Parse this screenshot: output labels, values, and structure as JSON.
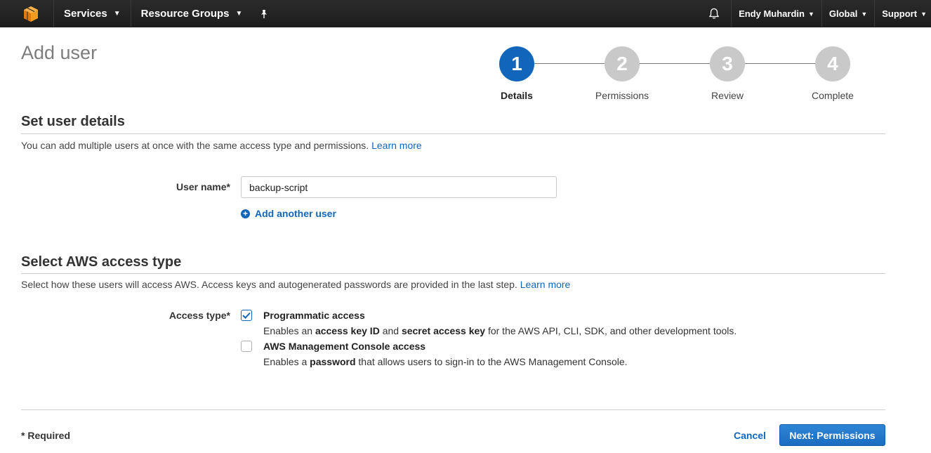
{
  "topnav": {
    "logo_icon": "aws-cube-icon",
    "services": "Services",
    "resource_groups": "Resource Groups",
    "pin_icon": "pin-icon",
    "bell_icon": "bell-icon",
    "user": "Endy Muhardin",
    "region": "Global",
    "support": "Support"
  },
  "page": {
    "title": "Add user"
  },
  "wizard": {
    "steps": [
      {
        "number": "1",
        "label": "Details",
        "active": true
      },
      {
        "number": "2",
        "label": "Permissions",
        "active": false
      },
      {
        "number": "3",
        "label": "Review",
        "active": false
      },
      {
        "number": "4",
        "label": "Complete",
        "active": false
      }
    ]
  },
  "user_details": {
    "title": "Set user details",
    "description": "You can add multiple users at once with the same access type and permissions.",
    "learn_more": "Learn more",
    "user_name_label": "User name*",
    "user_name_value": "backup-script",
    "add_another": "Add another user"
  },
  "access_type": {
    "title": "Select AWS access type",
    "description": "Select how these users will access AWS. Access keys and autogenerated passwords are provided in the last step.",
    "learn_more": "Learn more",
    "label": "Access type*",
    "options": [
      {
        "title": "Programmatic access",
        "checked": true,
        "desc_1": "Enables an ",
        "desc_2": "access key ID",
        "desc_3": " and ",
        "desc_4": "secret access key",
        "desc_5": " for the AWS API, CLI, SDK, and other development tools."
      },
      {
        "title": "AWS Management Console access",
        "checked": false,
        "desc_1": "Enables a ",
        "desc_2": "password",
        "desc_3": " that allows users to sign-in to the AWS Management Console."
      }
    ]
  },
  "footer": {
    "required": "* Required",
    "cancel": "Cancel",
    "next": "Next: Permissions"
  },
  "colors": {
    "accent": "#1166bb",
    "nav_bg": "#232323",
    "step_inactive": "#c9c9c9"
  }
}
